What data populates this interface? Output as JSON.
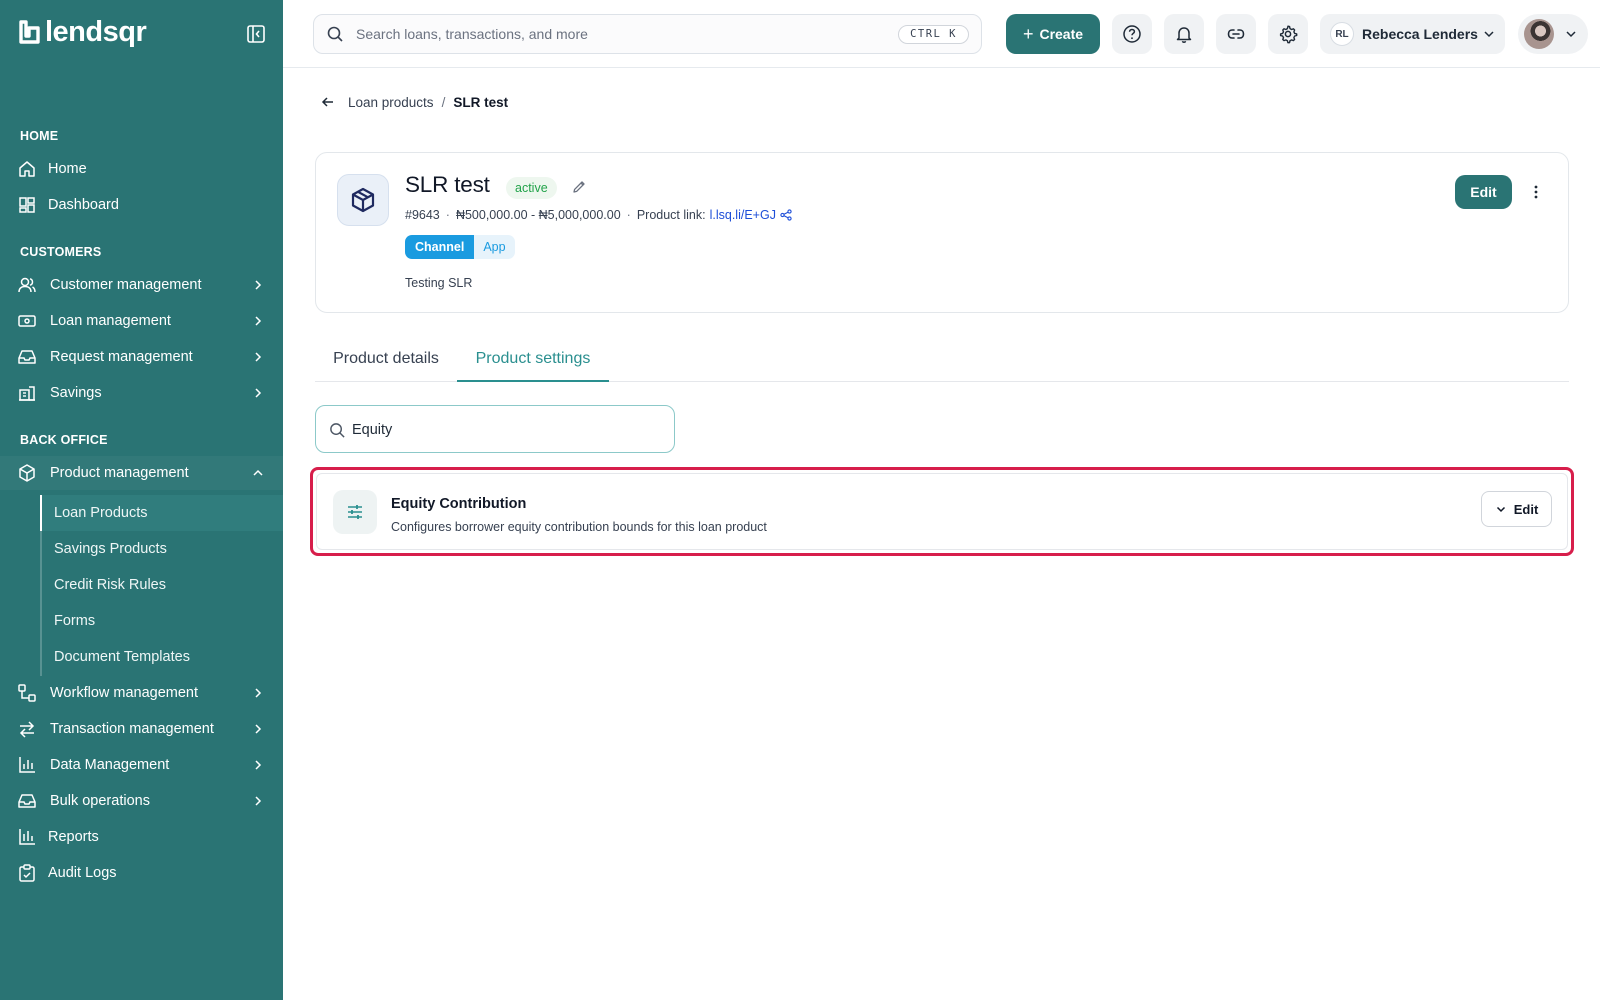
{
  "app": {
    "logo_text": "lendsqr"
  },
  "sidebar": {
    "sections": {
      "home": "HOME",
      "customers": "CUSTOMERS",
      "back_office": "BACK OFFICE"
    },
    "items": {
      "home": "Home",
      "dashboard": "Dashboard",
      "customer_management": "Customer management",
      "loan_management": "Loan management",
      "request_management": "Request management",
      "savings": "Savings",
      "product_management": "Product management",
      "workflow_management": "Workflow management",
      "transaction_management": "Transaction management",
      "data_management": "Data Management",
      "bulk_operations": "Bulk operations",
      "reports": "Reports",
      "audit_logs": "Audit Logs"
    },
    "product_submenu": {
      "loan_products": "Loan Products",
      "savings_products": "Savings Products",
      "credit_risk_rules": "Credit Risk Rules",
      "forms": "Forms",
      "document_templates": "Document Templates"
    }
  },
  "topbar": {
    "search_placeholder": "Search loans, transactions, and more",
    "search_shortcut": "CTRL K",
    "create_label": "Create",
    "user_initials": "RL",
    "user_name": "Rebecca Lenders"
  },
  "breadcrumb": {
    "parent": "Loan products",
    "separator": "/",
    "current": "SLR test"
  },
  "product": {
    "title": "SLR test",
    "status": "active",
    "id": "#9643",
    "amount_range": "₦500,000.00 - ₦5,000,000.00",
    "link_label": "Product link:",
    "link": "l.lsq.li/E+GJ",
    "tag_channel": "Channel",
    "tag_app": "App",
    "description": "Testing SLR",
    "edit_label": "Edit"
  },
  "tabs": {
    "details": "Product details",
    "settings": "Product settings"
  },
  "settings_search": {
    "value": "Equity"
  },
  "result": {
    "title": "Equity Contribution",
    "subtitle": "Configures borrower equity contribution bounds for this loan product",
    "edit_label": "Edit"
  },
  "colors": {
    "brand": "#2a7474",
    "accent_tab": "#2a8f8f",
    "highlight": "#d71e4b",
    "status_green": "#22a34a",
    "channel_blue": "#1a9be0"
  },
  "icons": {
    "sidebar": [
      "home-icon",
      "dashboard-icon",
      "users-icon",
      "banknote-icon",
      "inbox-icon",
      "building-icon",
      "package-icon",
      "workflow-icon",
      "arrows-exchange-icon",
      "bar-chart-icon",
      "inbox-stack-icon",
      "reports-icon",
      "clipboard-check-icon"
    ],
    "topbar": [
      "search-icon",
      "plus-icon",
      "help-icon",
      "bell-icon",
      "link-icon",
      "gear-icon",
      "chevron-down-icon"
    ],
    "content": [
      "arrow-left-icon",
      "package-icon",
      "pencil-icon",
      "share-icon",
      "more-vertical-icon",
      "sliders-icon",
      "chevron-down-icon"
    ]
  }
}
